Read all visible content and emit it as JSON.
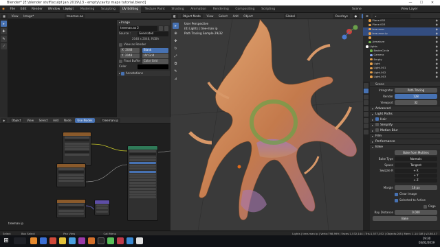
{
  "window": {
    "title": "Blender* [E:\\blender stuff\\sculpt jan 2019\\13 - empty\\cavity maps tutorial.blend]",
    "min": "—",
    "max": "☐",
    "close": "✕"
  },
  "menu": [
    "File",
    "Edit",
    "Render",
    "Window",
    "Help"
  ],
  "workspaces": [
    {
      "label": "Layout",
      "active": false
    },
    {
      "label": "Modeling",
      "active": false
    },
    {
      "label": "Sculpting",
      "active": false
    },
    {
      "label": "UV Editing",
      "active": true
    },
    {
      "label": "Texture Paint",
      "active": false
    },
    {
      "label": "Shading",
      "active": false
    },
    {
      "label": "Animation",
      "active": false
    },
    {
      "label": "Rendering",
      "active": false
    },
    {
      "label": "Compositing",
      "active": false
    },
    {
      "label": "Scripting",
      "active": false
    }
  ],
  "scene_field": "Scene",
  "view_layer_field": "View Layer",
  "image_editor": {
    "header": [
      "View",
      "Image*",
      "treeman.ao"
    ],
    "panel_title": "Image",
    "image_name": "treeman.ao 2",
    "source_label": "Source :",
    "source_value": "Generated",
    "size_row": "2048 x 2048, RGBA",
    "view_as_render": "View as Render",
    "x_label": "X",
    "x_value": "2048",
    "y_label": "Y",
    "y_value": "2048",
    "float_buffer": "Float Buffer",
    "gen_types": [
      "Blank",
      "UV Grid",
      "Color Grid"
    ],
    "color_label": "Color",
    "annotations": "Annotations"
  },
  "node_editor": {
    "header": [
      "Object",
      "View",
      "Select",
      "Add",
      "Node"
    ],
    "use_nodes": "Use Nodes",
    "slot": "treeman.ip",
    "label": "treeman ip"
  },
  "viewport": {
    "header_left": [
      "Object Mode",
      "View",
      "Select",
      "Add",
      "Object"
    ],
    "transform": "Global",
    "overlays": "Overlays",
    "info_lines": [
      "User Perspective",
      "(0) Lights | tree-man ip",
      "Path Tracing Sample 29/32"
    ]
  },
  "outliner": {
    "rows": [
      {
        "label": "Plane.002",
        "sel": false,
        "col": "#e6a04a",
        "indent": 6
      },
      {
        "label": "Plane.003",
        "sel": false,
        "col": "#e6a04a",
        "indent": 6
      },
      {
        "label": "tree-man",
        "sel": true,
        "col": "#e6a04a",
        "indent": 6
      },
      {
        "label": "tree-man.ip",
        "sel": true,
        "col": "#e6a04a",
        "indent": 6
      },
      {
        "label": "",
        "sel": false,
        "col": "#e6a04a",
        "indent": 6
      },
      {
        "label": "Armature",
        "sel": false,
        "col": "#6fb04a",
        "indent": 6
      },
      {
        "label": "Lights",
        "sel": false,
        "col": "#ffffff",
        "indent": 2
      },
      {
        "label": "BezierCircle",
        "sel": false,
        "col": "#6fb04a",
        "indent": 8
      },
      {
        "label": "Camera",
        "sel": false,
        "col": "#8fb0ff",
        "indent": 8
      },
      {
        "label": "Empty",
        "sel": false,
        "col": "#e6a04a",
        "indent": 8
      },
      {
        "label": "Light",
        "sel": false,
        "col": "#e6a04a",
        "indent": 8
      },
      {
        "label": "Light.001",
        "sel": false,
        "col": "#e6a04a",
        "indent": 8
      },
      {
        "label": "Light.002",
        "sel": false,
        "col": "#e6a04a",
        "indent": 8
      },
      {
        "label": "Light.003",
        "sel": false,
        "col": "#e6a04a",
        "indent": 8
      }
    ]
  },
  "properties": {
    "title": "Scene",
    "integrator_label": "Integrator",
    "integrator_value": "Path Tracing",
    "render_label": "Render",
    "render_value": "128",
    "viewport_label": "Viewport",
    "viewport_value": "32",
    "sections_mid": [
      {
        "label": "Advanced",
        "open": true
      },
      {
        "label": "Light Paths",
        "open": false
      },
      {
        "label": "Hair",
        "open": false,
        "check": true
      },
      {
        "label": "Simplify",
        "open": false,
        "check": true
      },
      {
        "label": "Motion Blur",
        "open": false,
        "check": true
      },
      {
        "label": "Film",
        "open": false
      },
      {
        "label": "Performance",
        "open": false
      },
      {
        "label": "Bake",
        "open": true
      }
    ],
    "bake_button": "Bake from Multires",
    "bake_type_label": "Bake Type",
    "bake_type_value": "Normals",
    "space_label": "Space",
    "space_value": "Tangent",
    "swizzle_label": "Swizzle R",
    "swizzle": [
      "+ X",
      "+ Y",
      "+ Z"
    ],
    "margin_label": "Margin",
    "margin_value": "16 px",
    "clear_image": "Clear Image",
    "selected_to_active": "Selected to Active",
    "cage": "Cage",
    "ray_distance_label": "Ray Distance",
    "ray_distance_value": "0.000",
    "bake_final": "Bake"
  },
  "status": {
    "left": [
      "Select",
      "Box Select",
      "Pan View",
      "Call Menu"
    ],
    "right": "Lights | tree-man ip | Verts:798,999 | Faces:1,532,144 | Tris:1,577,032 | Objects:2/8 | Mem: 1.14 GiB | v2.80.47"
  },
  "taskbar": {
    "time": "19:30",
    "date": "03/02/2019"
  }
}
